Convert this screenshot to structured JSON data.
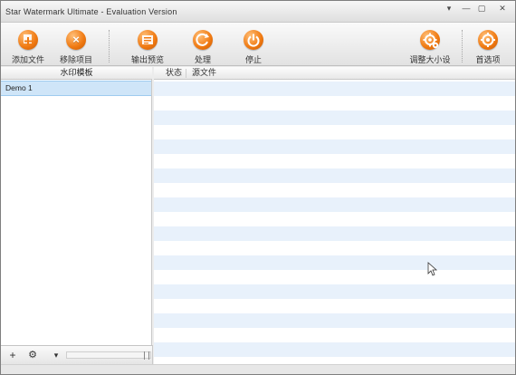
{
  "window": {
    "title": "Star Watermark Ultimate - Evaluation Version",
    "controls": [
      "help-down",
      "minimize",
      "maximize",
      "close"
    ]
  },
  "toolbar": {
    "buttons": [
      {
        "label": "添加文件",
        "icon": "add-file-icon"
      },
      {
        "label": "移除项目",
        "icon": "remove-item-icon"
      },
      {
        "label": "输出预览",
        "icon": "output-preview-icon"
      },
      {
        "label": "处理",
        "icon": "process-icon"
      },
      {
        "label": "停止",
        "icon": "stop-icon"
      },
      {
        "label": "调整大小设置",
        "icon": "resize-settings-icon"
      },
      {
        "label": "首选项",
        "icon": "preferences-icon"
      }
    ]
  },
  "templates": {
    "header": "水印模板",
    "items": [
      "Demo 1"
    ]
  },
  "files": {
    "columns": [
      "状态",
      "源文件"
    ],
    "rows": []
  },
  "bottom_controls": {
    "add": "+",
    "settings": "⚙",
    "menu": "▾"
  },
  "colors": {
    "accent_orange": "#f07a12",
    "selection_blue": "#cfe5f8",
    "stripe_blue": "#e8f1fb"
  }
}
